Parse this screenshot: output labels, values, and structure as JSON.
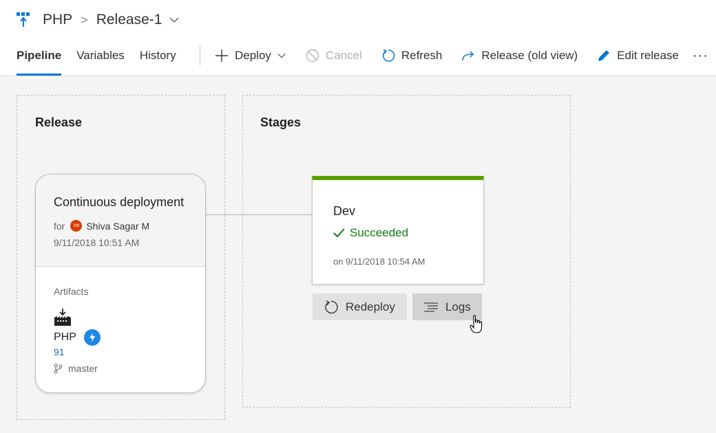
{
  "breadcrumb": {
    "project": "PHP",
    "separator": ">",
    "release": "Release-1"
  },
  "tabs": [
    {
      "label": "Pipeline",
      "active": true
    },
    {
      "label": "Variables",
      "active": false
    },
    {
      "label": "History",
      "active": false
    }
  ],
  "toolbar": {
    "deploy": "Deploy",
    "cancel": "Cancel",
    "refresh": "Refresh",
    "old_view": "Release (old view)",
    "edit": "Edit release",
    "more": "···"
  },
  "release_panel": {
    "title": "Release",
    "trigger": {
      "title": "Continuous deployment",
      "for_label": "for",
      "user_initials": "SM",
      "user": "Shiva Sagar M",
      "date": "9/11/2018 10:51 AM"
    },
    "artifacts_label": "Artifacts",
    "artifact": {
      "name": "PHP",
      "build": "91",
      "branch": "master"
    }
  },
  "stages_panel": {
    "title": "Stages",
    "stage": {
      "name": "Dev",
      "status": "Succeeded",
      "date": "on 9/11/2018 10:54 AM"
    },
    "actions": {
      "redeploy": "Redeploy",
      "logs": "Logs"
    }
  },
  "colors": {
    "accent": "#0078d4",
    "success": "#57a300",
    "success_text": "#107c10",
    "avatar": "#d83b01",
    "trigger_badge": "#1e88e5"
  }
}
